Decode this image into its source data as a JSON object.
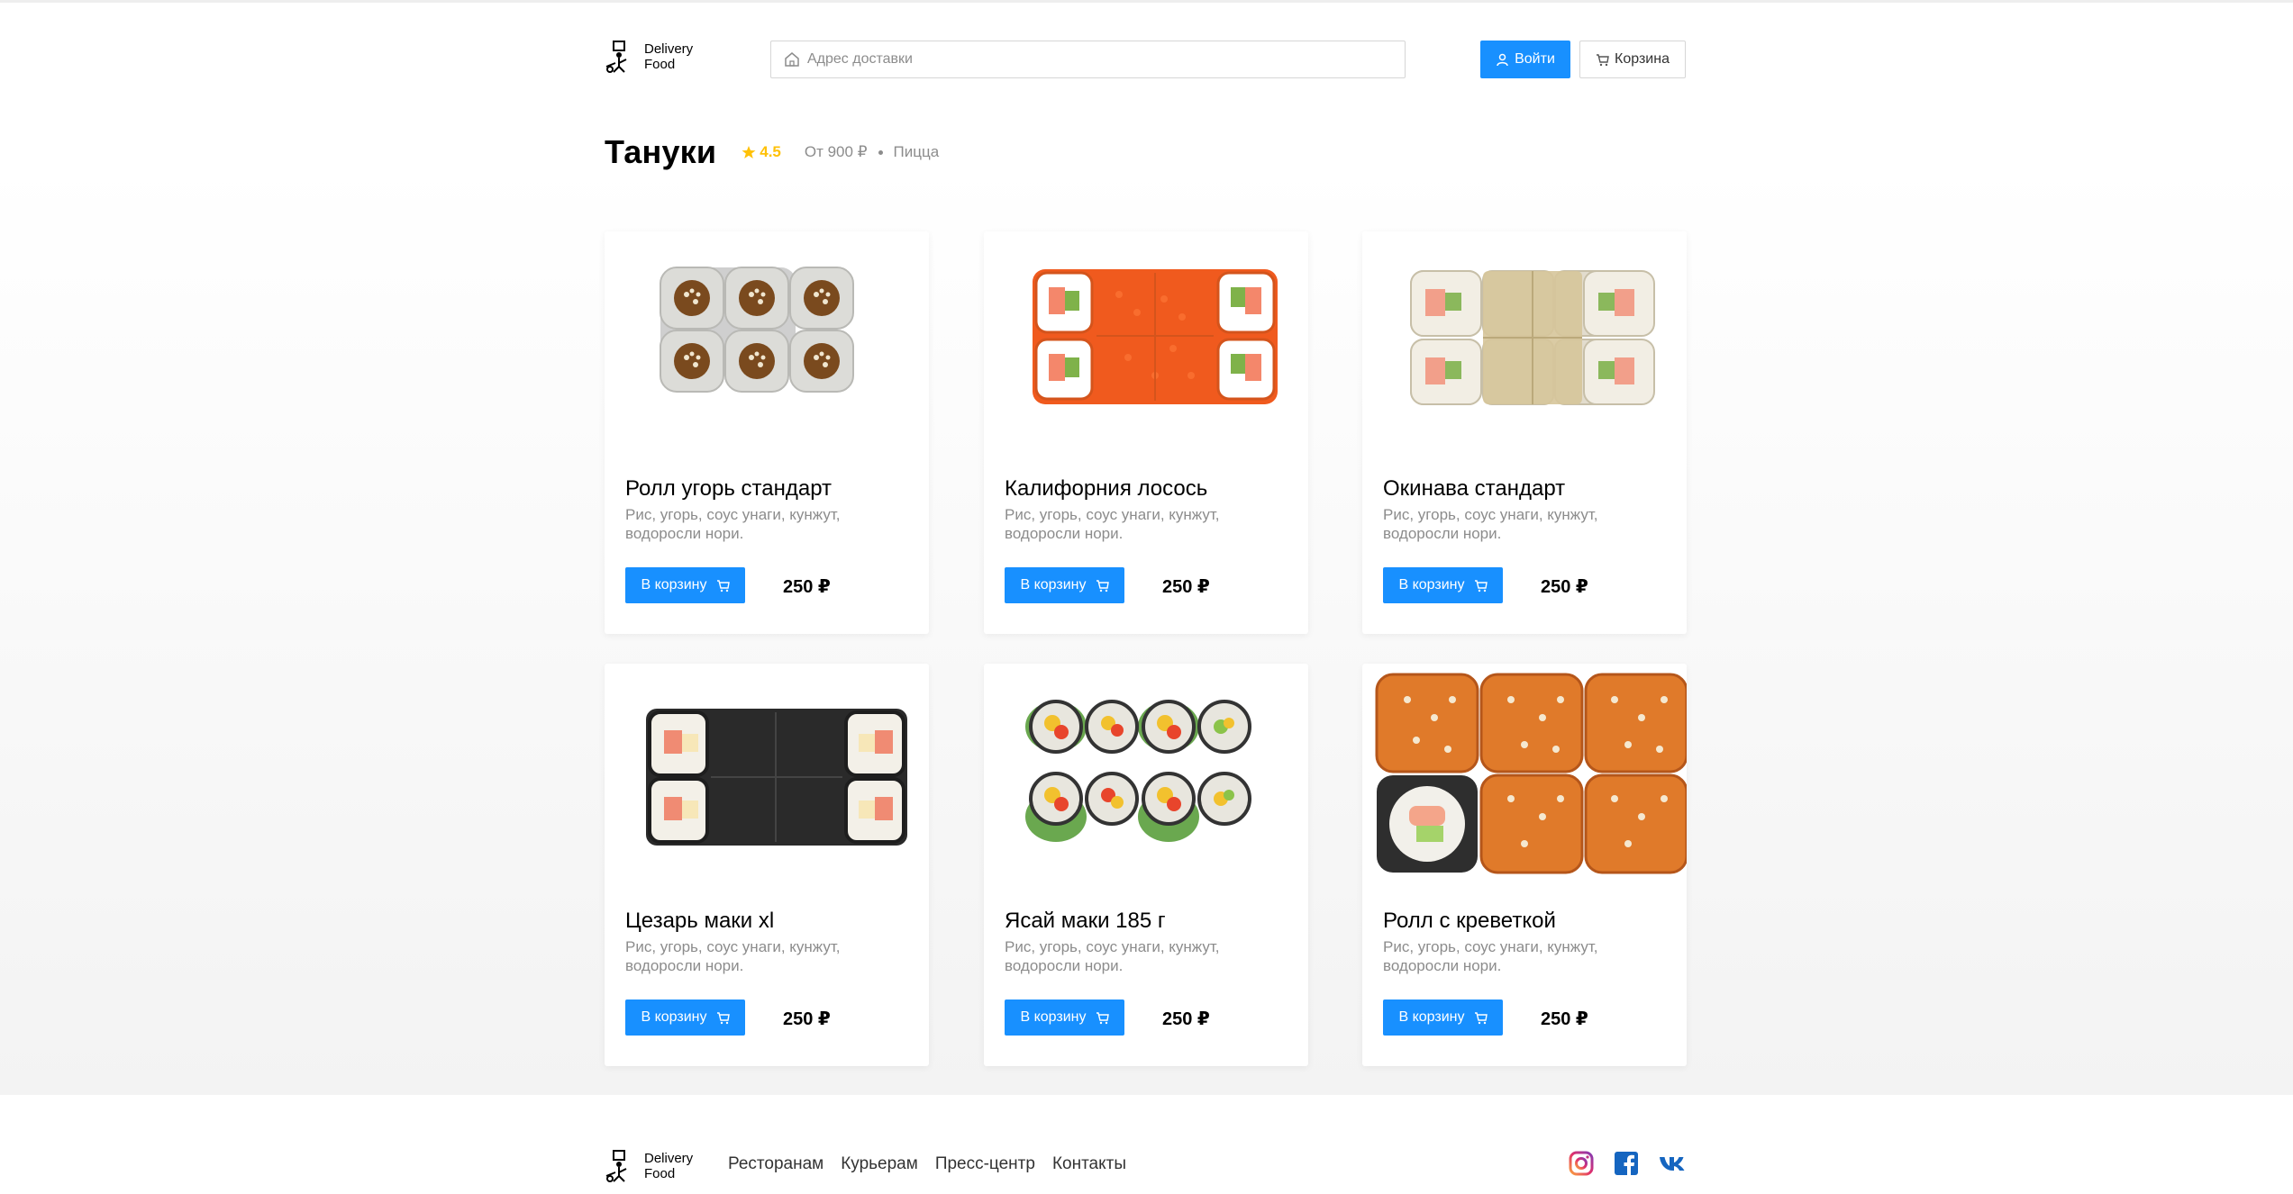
{
  "header": {
    "logo_text": "Delivery Food",
    "search_placeholder": "Адрес доставки",
    "login_label": "Войти",
    "cart_label": "Корзина"
  },
  "restaurant": {
    "name": "Тануки",
    "rating": "4.5",
    "price_from": "От 900 ₽",
    "kitchen": "Пицца"
  },
  "products": [
    {
      "title": "Ролл угорь стандарт",
      "description": "Рис, угорь, соус унаги, кунжут, водоросли нори.",
      "button": "В корзину",
      "price": "250 ₽",
      "image_icon": "eel-roll-image"
    },
    {
      "title": "Калифорния лосось",
      "description": "Рис, угорь, соус унаги, кунжут, водоросли нори.",
      "button": "В корзину",
      "price": "250 ₽",
      "image_icon": "california-roll-image"
    },
    {
      "title": "Окинава стандарт",
      "description": "Рис, угорь, соус унаги, кунжут, водоросли нори.",
      "button": "В корзину",
      "price": "250 ₽",
      "image_icon": "okinawa-roll-image"
    },
    {
      "title": "Цезарь маки xl",
      "description": "Рис, угорь, соус унаги, кунжут, водоросли нори.",
      "button": "В корзину",
      "price": "250 ₽",
      "image_icon": "caesar-maki-image"
    },
    {
      "title": "Ясай маки 185 г",
      "description": "Рис, угорь, соус унаги, кунжут, водоросли нори.",
      "button": "В корзину",
      "price": "250 ₽",
      "image_icon": "yasai-maki-image"
    },
    {
      "title": "Ролл с креветкой",
      "description": "Рис, угорь, соус унаги, кунжут, водоросли нори.",
      "button": "В корзину",
      "price": "250 ₽",
      "image_icon": "shrimp-roll-image"
    }
  ],
  "footer": {
    "logo_text": "Delivery Food",
    "nav": [
      "Ресторанам",
      "Курьерам",
      "Пресс-центр",
      "Контакты"
    ],
    "socials": [
      "instagram-icon",
      "facebook-icon",
      "vk-icon"
    ]
  },
  "colors": {
    "accent": "#1890ff",
    "star": "#ffc107",
    "muted": "#8c8c8c"
  }
}
